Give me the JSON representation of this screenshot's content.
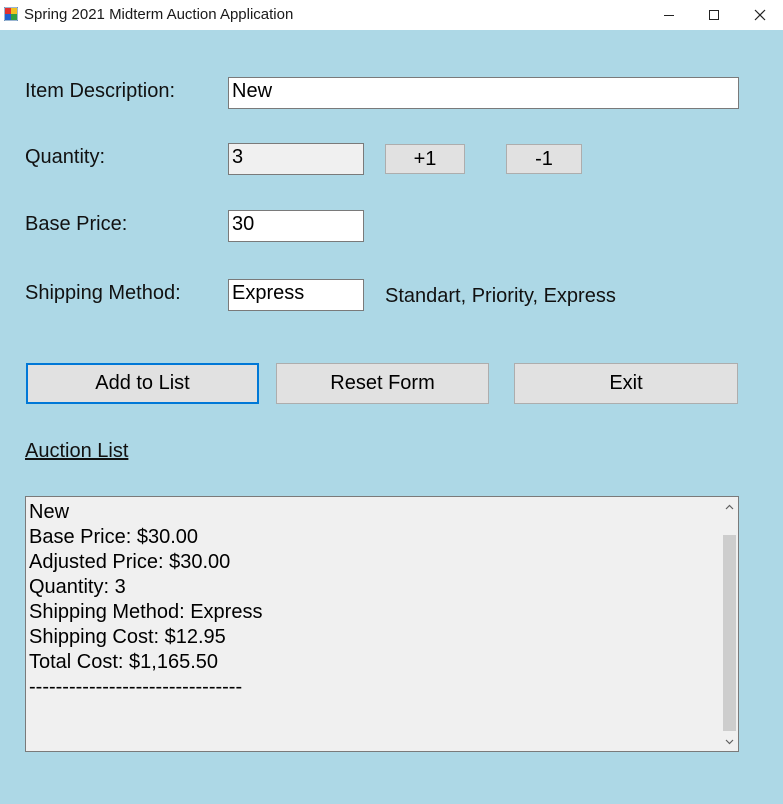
{
  "window": {
    "title": "Spring 2021 Midterm Auction Application",
    "minimize_icon": "minimize-icon",
    "maximize_icon": "maximize-icon",
    "close_icon": "close-icon"
  },
  "form": {
    "item_description_label": "Item Description:",
    "item_description_value": "New",
    "quantity_label": "Quantity:",
    "quantity_value": "3",
    "increment_label": "+1",
    "decrement_label": "-1",
    "base_price_label": "Base Price:",
    "base_price_value": "30",
    "shipping_method_label": "Shipping Method:",
    "shipping_method_value": "Express",
    "shipping_options_hint": "Standart, Priority, Express"
  },
  "actions": {
    "add_label": "Add to List",
    "reset_label": "Reset Form",
    "exit_label": "Exit"
  },
  "auction_list": {
    "heading": "Auction List",
    "lines": [
      "New",
      "Base Price: $30.00",
      "Adjusted Price: $30.00",
      "Quantity: 3",
      "Shipping Method: Express",
      "Shipping Cost: $12.95",
      "Total Cost: $1,165.50",
      "--------------------------------"
    ]
  },
  "colors": {
    "form_background": "#add8e6",
    "button_face": "#e1e1e1",
    "focus_border": "#0078d7"
  }
}
